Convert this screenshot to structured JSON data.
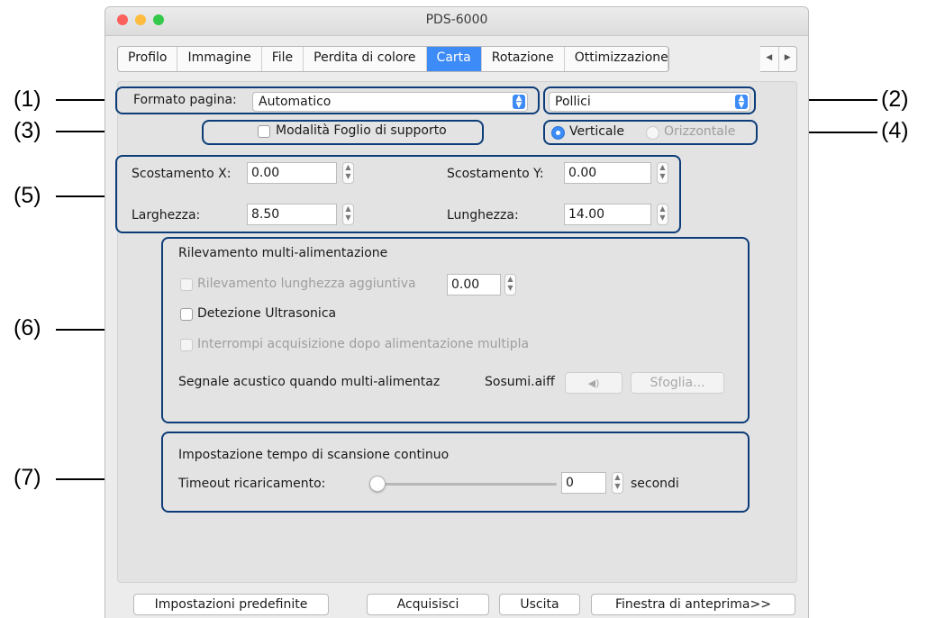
{
  "window": {
    "title": "PDS-6000",
    "traffic_lights": {
      "close": "#fc605c",
      "minimize": "#fdbc40",
      "zoom": "#34c84a"
    }
  },
  "tabs": [
    {
      "label": "Profilo",
      "active": false
    },
    {
      "label": "Immagine",
      "active": false
    },
    {
      "label": "File",
      "active": false
    },
    {
      "label": "Perdita di colore",
      "active": false
    },
    {
      "label": "Carta",
      "active": true
    },
    {
      "label": "Rotazione",
      "active": false
    },
    {
      "label": "Ottimizzazione",
      "active": false
    }
  ],
  "page_format": {
    "label": "Formato pagina:",
    "value": "Automatico"
  },
  "unit": {
    "value": "Pollici"
  },
  "carrier_sheet": {
    "label": "Modalità Foglio di supporto",
    "checked": false
  },
  "orientation": {
    "vertical": "Verticale",
    "horizontal": "Orizzontale",
    "selected": "Verticale"
  },
  "offsets": {
    "x_label": "Scostamento X:",
    "x_value": "0.00",
    "y_label": "Scostamento Y:",
    "y_value": "0.00",
    "width_label": "Larghezza:",
    "width_value": "8.50",
    "length_label": "Lunghezza:",
    "length_value": "14.00"
  },
  "multifeed": {
    "title": "Rilevamento multi-alimentazione",
    "extra_length_label": "Rilevamento lunghezza aggiuntiva",
    "extra_length_value": "0.00",
    "ultrasonic_label": "Detezione Ultrasonica",
    "stop_label": "Interrompi acquisizione dopo alimentazione multipla",
    "sound_label": "Segnale acustico quando multi-alimentaz",
    "sound_file": "Sosumi.aiff",
    "play_icon": "speaker-icon",
    "browse_label": "Sfoglia..."
  },
  "continuous": {
    "title": "Impostazione tempo di scansione continuo",
    "timeout_label": "Timeout ricaricamento:",
    "timeout_value": "0",
    "unit": "secondi",
    "slider_fraction": 0
  },
  "footer": {
    "defaults": "Impostazioni predefinite",
    "scan": "Acquisisci",
    "exit": "Uscita",
    "preview": "Finestra di anteprima>>"
  },
  "callouts": [
    "(1)",
    "(2)",
    "(3)",
    "(4)",
    "(5)",
    "(6)",
    "(7)"
  ],
  "colors": {
    "accent": "#3d8bf7",
    "highlight": "#0d3d78"
  }
}
